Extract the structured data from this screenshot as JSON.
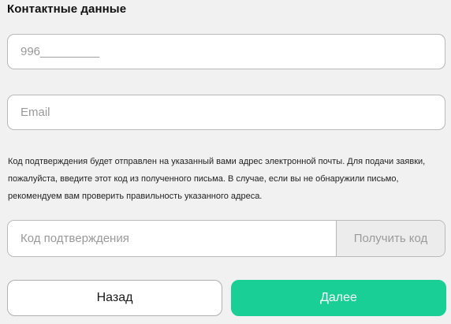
{
  "section": {
    "title": "Контактные данные"
  },
  "phone": {
    "placeholder": "996_________"
  },
  "email": {
    "placeholder": "Email"
  },
  "note": {
    "text": "Код подтверждения будет отправлен на указанный вами адрес электронной почты. Для подачи заявки, пожалуйста, введите этот код из полученного письма. В случае, если вы не обнаружили письмо, рекомендуем вам проверить правильность указанного адреса."
  },
  "verification": {
    "placeholder": "Код подтверждения",
    "get_code_label": "Получить код"
  },
  "actions": {
    "back_label": "Назад",
    "next_label": "Далее"
  },
  "colors": {
    "accent": "#19cf95",
    "background": "#f1f1f1"
  }
}
